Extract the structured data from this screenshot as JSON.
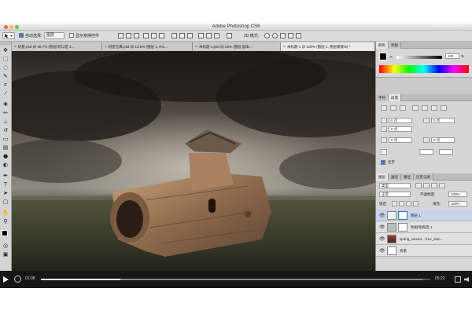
{
  "window": {
    "title": "Adobe Photoshop CS6"
  },
  "watermark": "快速回",
  "options_bar": {
    "auto_select_label": "自动选择:",
    "auto_select_value": "图层",
    "show_transform_label": "显示变换控件",
    "mode_3d_label": "3D 模式:"
  },
  "tabs": [
    {
      "label": "树屋.psd @ 66.7% (图层/可以是 3..."
    },
    {
      "label": "树屋仓库.psd @ 12.5% (图层 1, RG..."
    },
    {
      "label": "未标题-1.psd @ 25% (图层 副本..."
    },
    {
      "label": "未标题-1 @ 100% (图层 1, 图层蒙版/8) *"
    }
  ],
  "panels": {
    "color_tabs": [
      "颜色",
      "色板"
    ],
    "k_label": "K",
    "k_value": "100",
    "percent": "%",
    "char_tabs": [
      "字符",
      "段落"
    ],
    "indent_values": [
      "0 点",
      "0 点",
      "0 点",
      "0 点",
      "0 点"
    ],
    "hyphenate_label": "连字",
    "layer_tabs": [
      "图层",
      "通道",
      "路径",
      "历史记录"
    ],
    "kind_label": "类型",
    "blend_mode": "正常",
    "opacity_label": "不透明度:",
    "opacity_value": "100%",
    "lock_label": "锁定:",
    "fill_label": "填充:",
    "fill_value": "100%",
    "layers": [
      {
        "name": "图层 1",
        "selected": true
      },
      {
        "name": "色相/饱和度 1",
        "selected": false
      },
      {
        "name": "spring_sunset... free_stoc...",
        "selected": false
      },
      {
        "name": "背景",
        "selected": false
      }
    ]
  },
  "player": {
    "current_time": "01:08",
    "total_time": "05:22",
    "progress": 0.205,
    "buffered": 0.98
  }
}
